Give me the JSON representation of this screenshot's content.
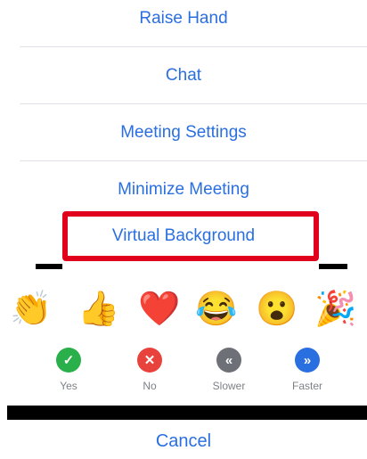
{
  "menu": {
    "items": [
      {
        "label": "Raise Hand"
      },
      {
        "label": "Chat"
      },
      {
        "label": "Meeting Settings"
      },
      {
        "label": "Minimize Meeting"
      },
      {
        "label": "Virtual Background"
      }
    ]
  },
  "reactions": [
    {
      "name": "clap",
      "glyph": "👏"
    },
    {
      "name": "thumbs-up",
      "glyph": "👍"
    },
    {
      "name": "heart",
      "glyph": "❤️"
    },
    {
      "name": "joy",
      "glyph": "😂"
    },
    {
      "name": "open-mouth",
      "glyph": "😮"
    },
    {
      "name": "party",
      "glyph": "🎉"
    }
  ],
  "status_buttons": [
    {
      "label": "Yes",
      "glyph": "✓",
      "color": "#29b04a"
    },
    {
      "label": "No",
      "glyph": "✕",
      "color": "#e8423c"
    },
    {
      "label": "Slower",
      "glyph": "«",
      "color": "#6d7076"
    },
    {
      "label": "Faster",
      "glyph": "»",
      "color": "#2a6fe0"
    }
  ],
  "cancel": {
    "label": "Cancel"
  },
  "colors": {
    "accent": "#2a6fe0",
    "highlight": "#e1001b"
  }
}
